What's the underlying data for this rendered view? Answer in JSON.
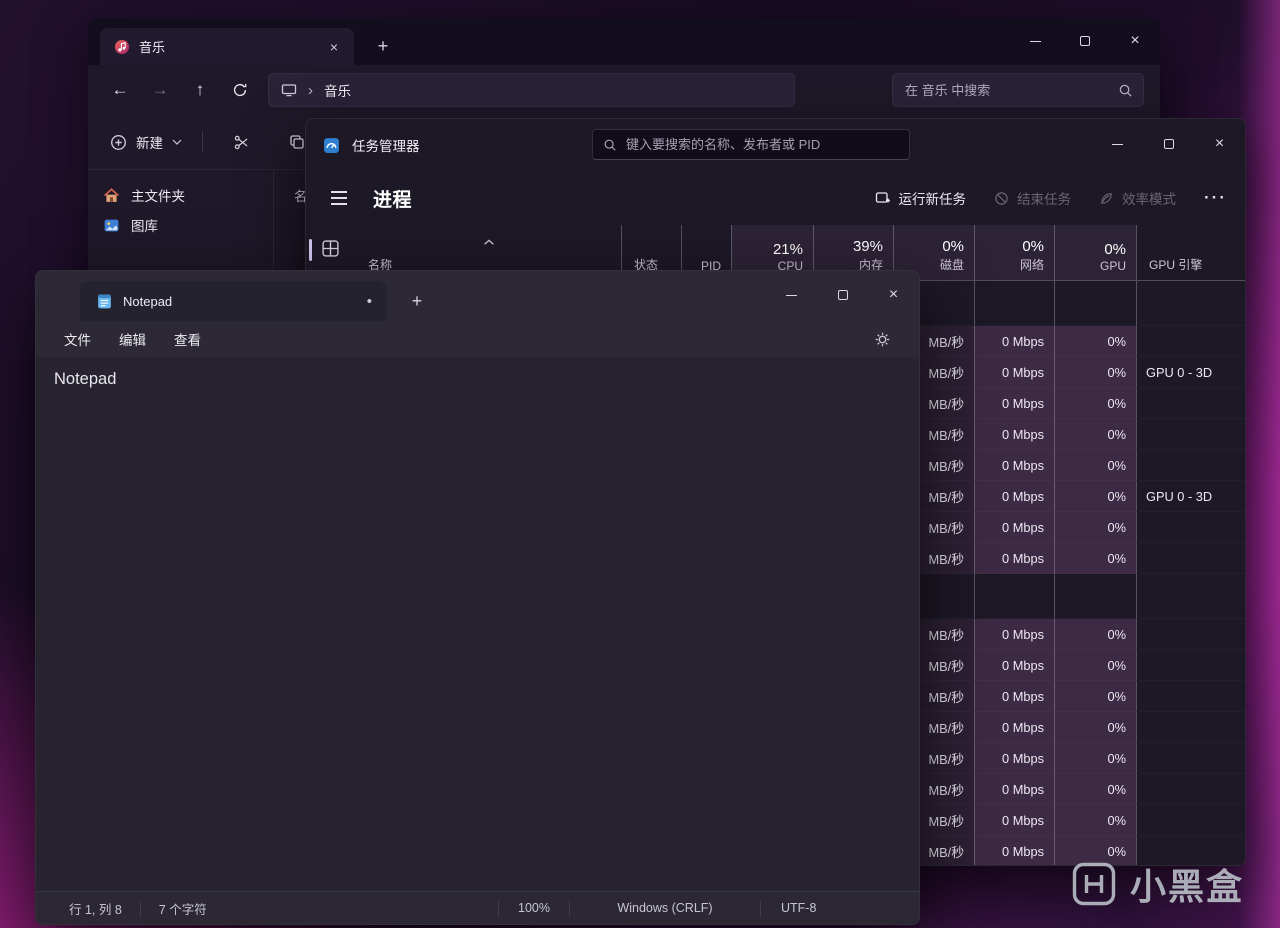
{
  "explorer": {
    "tab_title": "音乐",
    "new_tab_glyph": "+",
    "breadcrumb_item": "音乐",
    "search_placeholder": "在 音乐 中搜索",
    "new_button_label": "新建",
    "sidebar_items": [
      {
        "label": "主文件夹"
      },
      {
        "label": "图库"
      }
    ],
    "list_column_partial": "名"
  },
  "taskmgr": {
    "title": "任务管理器",
    "search_placeholder": "键入要搜索的名称、发布者或 PID",
    "page_title": "进程",
    "actions": {
      "run_new_task": "运行新任务",
      "end_task": "结束任务",
      "efficiency_mode": "效率模式",
      "more": "···"
    },
    "columns": {
      "name": "名称",
      "status": "状态",
      "pid": "PID",
      "cpu_pct": "21%",
      "cpu_label": "CPU",
      "mem_pct": "39%",
      "mem_label": "内存",
      "disk_pct": "0%",
      "disk_label": "磁盘",
      "net_pct": "0%",
      "net_label": "网络",
      "gpu_pct": "0%",
      "gpu_label": "GPU",
      "gpu_engine": "GPU 引擎"
    },
    "rows": [
      {
        "type": "group"
      },
      {
        "disk": "MB/秒",
        "net": "0 Mbps",
        "gpu": "0%",
        "engine": ""
      },
      {
        "disk": "MB/秒",
        "net": "0 Mbps",
        "gpu": "0%",
        "engine": "GPU 0 - 3D"
      },
      {
        "disk": "MB/秒",
        "net": "0 Mbps",
        "gpu": "0%",
        "engine": ""
      },
      {
        "disk": "MB/秒",
        "net": "0 Mbps",
        "gpu": "0%",
        "engine": ""
      },
      {
        "disk": "MB/秒",
        "net": "0 Mbps",
        "gpu": "0%",
        "engine": ""
      },
      {
        "disk": "MB/秒",
        "net": "0 Mbps",
        "gpu": "0%",
        "engine": "GPU 0 - 3D"
      },
      {
        "disk": "MB/秒",
        "net": "0 Mbps",
        "gpu": "0%",
        "engine": ""
      },
      {
        "disk": "MB/秒",
        "net": "0 Mbps",
        "gpu": "0%",
        "engine": ""
      },
      {
        "type": "group"
      },
      {
        "disk": "MB/秒",
        "net": "0 Mbps",
        "gpu": "0%",
        "engine": ""
      },
      {
        "disk": "MB/秒",
        "net": "0 Mbps",
        "gpu": "0%",
        "engine": ""
      },
      {
        "disk": "MB/秒",
        "net": "0 Mbps",
        "gpu": "0%",
        "engine": ""
      },
      {
        "disk": "MB/秒",
        "net": "0 Mbps",
        "gpu": "0%",
        "engine": ""
      },
      {
        "disk": "MB/秒",
        "net": "0 Mbps",
        "gpu": "0%",
        "engine": ""
      },
      {
        "disk": "MB/秒",
        "net": "0 Mbps",
        "gpu": "0%",
        "engine": ""
      },
      {
        "disk": "MB/秒",
        "net": "0 Mbps",
        "gpu": "0%",
        "engine": ""
      },
      {
        "disk": "MB/秒",
        "net": "0 Mbps",
        "gpu": "0%",
        "engine": ""
      }
    ]
  },
  "notepad": {
    "tab_title": "Notepad",
    "unsaved_dot": "•",
    "new_tab_glyph": "+",
    "menus": [
      {
        "label": "文件"
      },
      {
        "label": "编辑"
      },
      {
        "label": "查看"
      }
    ],
    "content_text": "Notepad",
    "statusbar": {
      "cursor": "行 1, 列 8",
      "char_count": "7 个字符",
      "zoom": "100%",
      "line_ending": "Windows (CRLF)",
      "encoding": "UTF-8"
    }
  },
  "watermark": {
    "text": "小黑盒"
  }
}
